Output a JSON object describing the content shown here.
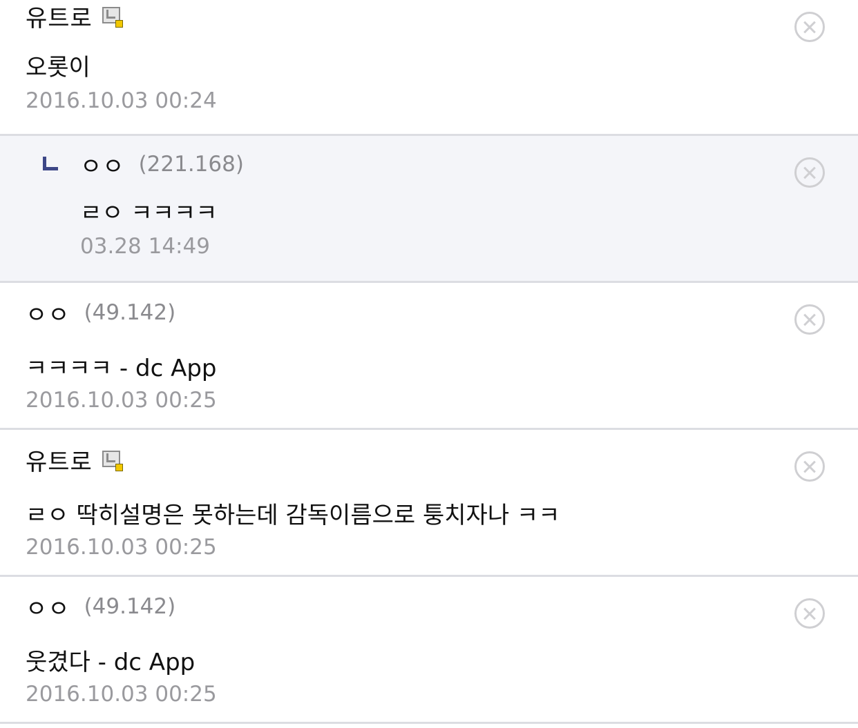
{
  "comments": [
    {
      "nickname": "유트로",
      "ip": "",
      "has_gallog_icon": true,
      "is_reply": false,
      "text": "오롯이",
      "time": "2016.10.03 00:24"
    },
    {
      "nickname": "ㅇㅇ",
      "ip": "(221.168)",
      "has_gallog_icon": false,
      "is_reply": true,
      "text": "ㄹㅇ ㅋㅋㅋㅋ",
      "time": "03.28 14:49"
    },
    {
      "nickname": "ㅇㅇ",
      "ip": "(49.142)",
      "has_gallog_icon": false,
      "is_reply": false,
      "text": "ㅋㅋㅋㅋ - dc App",
      "time": "2016.10.03 00:25"
    },
    {
      "nickname": "유트로",
      "ip": "",
      "has_gallog_icon": true,
      "is_reply": false,
      "text": "ㄹㅇ 딱히설명은 못하는데 감독이름으로 퉁치자나 ㅋㅋ",
      "time": "2016.10.03 00:25"
    },
    {
      "nickname": "ㅇㅇ",
      "ip": "(49.142)",
      "has_gallog_icon": false,
      "is_reply": false,
      "text": "웃겼다 - dc App",
      "time": "2016.10.03 00:25"
    }
  ],
  "icons": {
    "delete": "close-circle-icon",
    "gallog": "gallog-icon",
    "reply": "reply-arrow-icon"
  },
  "colors": {
    "reply_background": "#f4f5f9",
    "divider": "#dcdde2",
    "reply_arrow": "#3d4787",
    "meta_text": "#9a9a9e"
  }
}
